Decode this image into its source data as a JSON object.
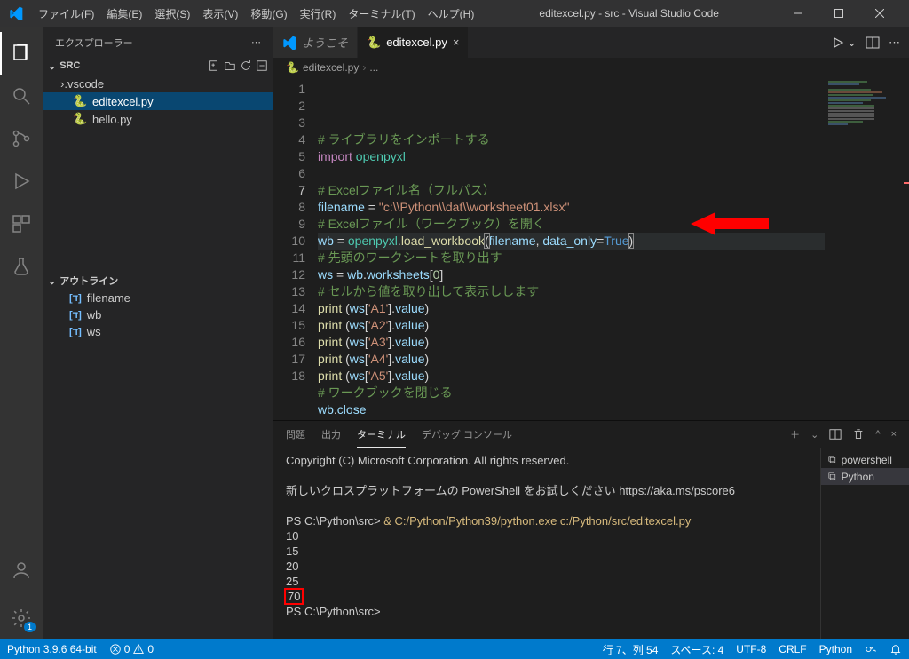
{
  "titlebar": {
    "menus": [
      "ファイル(F)",
      "編集(E)",
      "選択(S)",
      "表示(V)",
      "移動(G)",
      "実行(R)",
      "ターミナル(T)",
      "ヘルプ(H)"
    ],
    "title": "editexcel.py - src - Visual Studio Code"
  },
  "sidebar": {
    "title": "エクスプローラー",
    "root": "SRC",
    "folders": [
      ".vscode"
    ],
    "files": [
      "editexcel.py",
      "hello.py"
    ],
    "selected": "editexcel.py",
    "outline_title": "アウトライン",
    "outline_items": [
      "filename",
      "wb",
      "ws"
    ]
  },
  "tabs": {
    "welcome": "ようこそ",
    "file": "editexcel.py"
  },
  "breadcrumbs": {
    "file": "editexcel.py",
    "rest": "..."
  },
  "code": {
    "lines": [
      {
        "n": 1,
        "html": "<span class='c-comment'># ライブラリをインポートする</span>"
      },
      {
        "n": 2,
        "html": "<span class='c-keyword'>import</span> <span class='c-module'>openpyxl</span>"
      },
      {
        "n": 3,
        "html": ""
      },
      {
        "n": 4,
        "html": "<span class='c-comment'># Excelファイル名（フルパス）</span>"
      },
      {
        "n": 5,
        "html": "<span class='c-var'>filename</span> = <span class='c-string'>\"c:\\\\Python\\\\dat\\\\worksheet01.xlsx\"</span>"
      },
      {
        "n": 6,
        "html": "<span class='c-comment'># Excelファイル（ワークブック）を開く</span>"
      },
      {
        "n": 7,
        "html": "<span class='c-var'>wb</span> = <span class='c-module'>openpyxl</span>.<span class='c-func'>load_workbook</span><span class='bracket-box'>(</span><span class='c-var'>filename</span>, <span class='c-var'>data_only</span>=<span class='c-const'>True</span><span class='bracket-box'>)</span>",
        "hl": true
      },
      {
        "n": 8,
        "html": "<span class='c-comment'># 先頭のワークシートを取り出す</span>"
      },
      {
        "n": 9,
        "html": "<span class='c-var'>ws</span> = <span class='c-var'>wb</span>.<span class='c-var'>worksheets</span>[<span class='c-num'>0</span>]"
      },
      {
        "n": 10,
        "html": "<span class='c-comment'># セルから値を取り出して表示しします</span>"
      },
      {
        "n": 11,
        "html": "<span class='c-func'>print</span> (<span class='c-var'>ws</span>[<span class='c-string'>'A1'</span>].<span class='c-var'>value</span>)"
      },
      {
        "n": 12,
        "html": "<span class='c-func'>print</span> (<span class='c-var'>ws</span>[<span class='c-string'>'A2'</span>].<span class='c-var'>value</span>)"
      },
      {
        "n": 13,
        "html": "<span class='c-func'>print</span> (<span class='c-var'>ws</span>[<span class='c-string'>'A3'</span>].<span class='c-var'>value</span>)"
      },
      {
        "n": 14,
        "html": "<span class='c-func'>print</span> (<span class='c-var'>ws</span>[<span class='c-string'>'A4'</span>].<span class='c-var'>value</span>)"
      },
      {
        "n": 15,
        "html": "<span class='c-func'>print</span> (<span class='c-var'>ws</span>[<span class='c-string'>'A5'</span>].<span class='c-var'>value</span>)"
      },
      {
        "n": 16,
        "html": "<span class='c-comment'># ワークブックを閉じる</span>"
      },
      {
        "n": 17,
        "html": "<span class='c-var'>wb</span>.<span class='c-var'>close</span>"
      },
      {
        "n": 18,
        "html": ""
      }
    ]
  },
  "panel": {
    "tabs": [
      "問題",
      "出力",
      "ターミナル",
      "デバッグ コンソール"
    ],
    "active_tab": 2,
    "side_items": [
      "powershell",
      "Python"
    ],
    "side_active": 1,
    "terminal_lines": [
      {
        "text": "Copyright (C) Microsoft Corporation. All rights reserved."
      },
      {
        "text": ""
      },
      {
        "text": "新しいクロスプラットフォームの PowerShell をお試しください https://aka.ms/pscore6"
      },
      {
        "text": ""
      },
      {
        "prompt": "PS C:\\Python\\src> ",
        "cmd": "& C:/Python/Python39/python.exe c:/Python/src/editexcel.py"
      },
      {
        "text": "10"
      },
      {
        "text": "15"
      },
      {
        "text": "20"
      },
      {
        "text": "25"
      },
      {
        "text": "70",
        "box": true
      },
      {
        "prompt": "PS C:\\Python\\src>",
        "cmd": ""
      }
    ]
  },
  "statusbar": {
    "python_version": "Python 3.9.6 64-bit",
    "problems_err": "0",
    "problems_warn": "0",
    "cursor": "行 7、列 54",
    "spaces": "スペース: 4",
    "encoding": "UTF-8",
    "eol": "CRLF",
    "lang": "Python"
  }
}
